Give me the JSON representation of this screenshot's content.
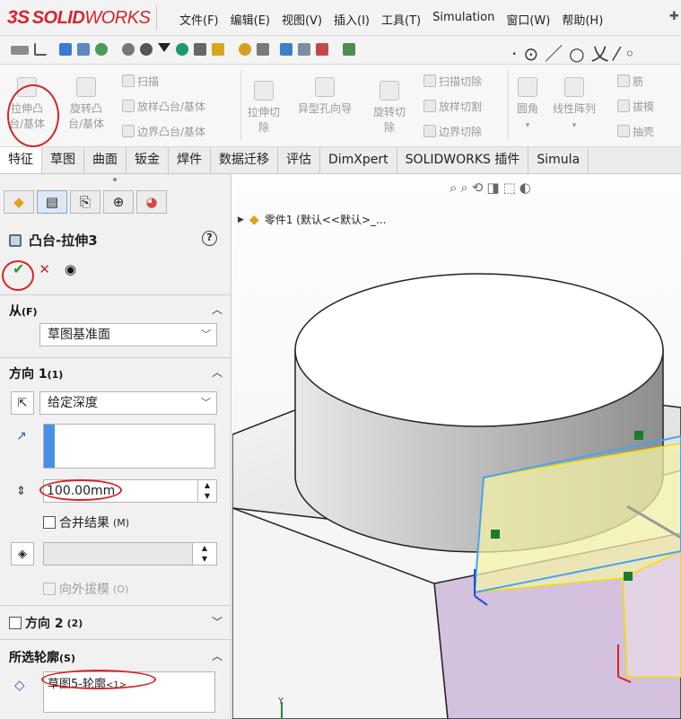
{
  "app": {
    "logo_ds": "3S",
    "logo_bold": "SOLID",
    "logo_light": "WORKS",
    "menu": [
      "文件(F)",
      "编辑(E)",
      "视图(V)",
      "插入(I)",
      "工具(T)",
      "Simulation",
      "窗口(W)",
      "帮助(H)"
    ]
  },
  "ribbon": {
    "extrude_boss_line1": "拉伸凸",
    "extrude_boss_line2": "台/基体",
    "revolve_line1": "旋转凸",
    "revolve_line2": "台/基体",
    "sweep": "扫描",
    "loft": "放样凸台/基体",
    "boundary": "边界凸台/基体",
    "extrude_cut_line1": "拉伸切",
    "extrude_cut_line2": "除",
    "hole_wizard": "异型孔向导",
    "revolve_cut_line1": "旋转切",
    "revolve_cut_line2": "除",
    "swept_cut": "扫描切除",
    "lofted_cut": "放样切割",
    "boundary_cut": "边界切除",
    "fillet": "圆角",
    "linear_pattern": "线性阵列",
    "rib": "筋",
    "draft": "拔模",
    "shell": "抽壳"
  },
  "tabs": [
    "特征",
    "草图",
    "曲面",
    "钣金",
    "焊件",
    "数据迁移",
    "评估",
    "DimXpert",
    "SOLIDWORKS 插件",
    "Simula"
  ],
  "active_tab": "特征",
  "property_manager": {
    "title": "凸台-拉伸3",
    "help": "?",
    "from_label": "从",
    "from_key": "(F)",
    "from_value": "草图基准面",
    "direction1_label": "方向 1",
    "direction1_key": "(1)",
    "end_condition": "给定深度",
    "depth": "100.00mm",
    "merge_result": "合并结果",
    "merge_key": "(M)",
    "draft_outward": "向外拔模",
    "draft_key": "(O)",
    "direction2_label": "方向 2",
    "direction2_key": "(2)",
    "selected_contours_label": "所选轮廓",
    "selected_contours_key": "(S)",
    "contour_item": "草图5-轮廓",
    "contour_suffix": "<1>"
  },
  "viewport": {
    "tree_item": "零件1  (默认<<默认>_...",
    "axis_y": "Y"
  },
  "colors": {
    "annotation": "#d62424",
    "logo": "#d4262c",
    "preview_fill": "#f4f1a8",
    "preview_edge": "#f0e000",
    "selection_edge": "#4aa3f0",
    "base_side": "#d3c1dd"
  },
  "icons": {
    "ok": "check-icon",
    "cancel": "close-icon",
    "preview": "eye-icon",
    "feature": "extrude-feature-icon"
  }
}
